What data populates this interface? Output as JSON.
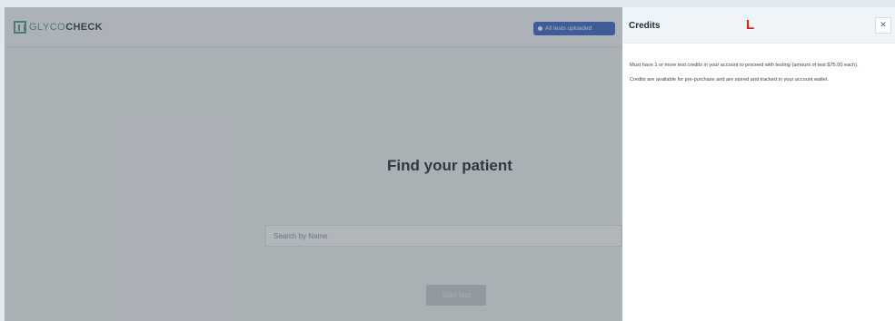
{
  "app": {
    "logo": {
      "part1": "GLYCO",
      "part2": "CHECK"
    },
    "status_badge": "All tests uploaded",
    "title": {
      "word1": "Find",
      "word2": "your",
      "word3": "patient"
    },
    "search": {
      "placeholder": "Search by Name"
    },
    "start_button_label": "Start test"
  },
  "credits_panel": {
    "title": "Credits",
    "marker": "L",
    "close_label": "✕",
    "paragraphs": [
      "Must have 1 or more test credits in your account to proceed with testing (amount of test $75.00 each).",
      "Credits are available for pre-purchase and are stored and tracked in your account wallet."
    ]
  }
}
